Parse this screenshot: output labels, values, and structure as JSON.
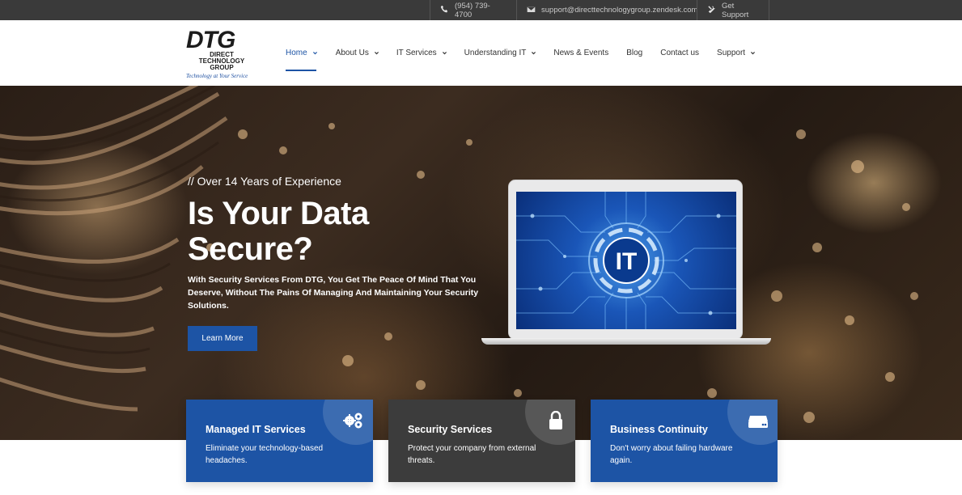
{
  "topbar": {
    "phone": "(954) 739-4700",
    "email": "support@directtechnologygroup.zendesk.com",
    "support": "Get Support"
  },
  "logo": {
    "mark": "DTG",
    "line1": "DIRECT",
    "line2": "TECHNOLOGY",
    "line3": "GROUP",
    "tagline": "Technology at Your Service"
  },
  "nav": {
    "items": [
      {
        "label": "Home",
        "dropdown": true,
        "active": true
      },
      {
        "label": "About Us",
        "dropdown": true
      },
      {
        "label": "IT Services",
        "dropdown": true
      },
      {
        "label": "Understanding IT",
        "dropdown": true
      },
      {
        "label": "News & Events",
        "dropdown": false
      },
      {
        "label": "Blog",
        "dropdown": false
      },
      {
        "label": "Contact us",
        "dropdown": false
      },
      {
        "label": "Support",
        "dropdown": true
      }
    ]
  },
  "hero": {
    "eyebrow": "// Over 14 Years of Experience",
    "headline": "Is Your Data Secure?",
    "subtext": "With Security Services From DTG, You Get The Peace Of Mind That You Deserve, Without The Pains Of Managing And Maintaining Your Security Solutions.",
    "cta": "Learn More",
    "screen_label": "IT"
  },
  "cards": [
    {
      "title": "Managed IT Services",
      "text": "Eliminate your technology-based headaches.",
      "icon": "gears-icon",
      "color": "#1d54a5"
    },
    {
      "title": "Security Services",
      "text": "Protect your company from external threats.",
      "icon": "lock-icon",
      "color": "#3c3c3c"
    },
    {
      "title": "Business Continuity",
      "text": "Don't worry about failing hardware again.",
      "icon": "server-icon",
      "color": "#1d54a5"
    }
  ],
  "colors": {
    "accent": "#1d54a5",
    "topbar": "#3a3a3a",
    "card_dark": "#3c3c3c"
  }
}
